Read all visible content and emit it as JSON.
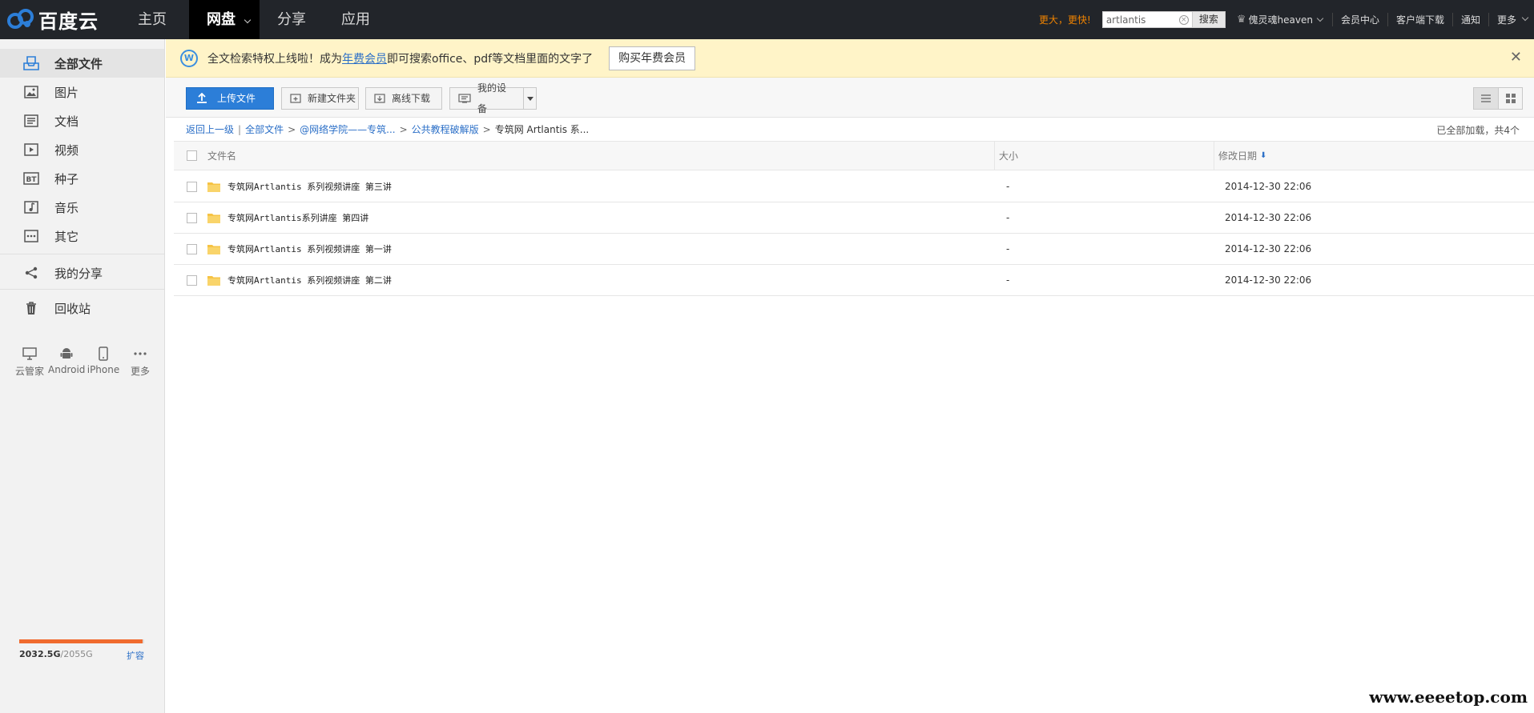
{
  "brand": {
    "name": "百度云"
  },
  "nav": {
    "items": [
      {
        "label": "主页"
      },
      {
        "label": "网盘"
      },
      {
        "label": "分享"
      },
      {
        "label": "应用"
      }
    ]
  },
  "topbar": {
    "promo": "更大，更快!",
    "search_value": "artlantis",
    "search_button": "搜索",
    "username": "傀灵魂heaven",
    "links": [
      "会员中心",
      "客户端下载",
      "通知"
    ],
    "more": "更多"
  },
  "sidebar": {
    "items": [
      {
        "label": "全部文件",
        "icon": "folder-all-icon"
      },
      {
        "label": "图片",
        "icon": "image-icon"
      },
      {
        "label": "文档",
        "icon": "document-icon"
      },
      {
        "label": "视频",
        "icon": "video-icon"
      },
      {
        "label": "种子",
        "icon": "bt-icon"
      },
      {
        "label": "音乐",
        "icon": "music-icon"
      },
      {
        "label": "其它",
        "icon": "other-icon"
      },
      {
        "label": "我的分享",
        "icon": "share-icon"
      },
      {
        "label": "回收站",
        "icon": "trash-icon"
      }
    ],
    "devices": [
      {
        "label": "云管家",
        "icon": "desktop-icon"
      },
      {
        "label": "Android",
        "icon": "android-icon"
      },
      {
        "label": "iPhone",
        "icon": "iphone-icon"
      },
      {
        "label": "更多",
        "icon": "more-dots-icon"
      }
    ],
    "quota": {
      "used": "2032.5G",
      "total": "/2055G",
      "fraction": 0.989,
      "expand": "扩容"
    }
  },
  "notice": {
    "text_before": "全文检索特权上线啦！成为",
    "link": "年费会员",
    "text_after": "即可搜索office、pdf等文档里面的文字了",
    "button": "购买年费会员"
  },
  "toolbar": {
    "upload": "上传文件",
    "new_folder": "新建文件夹",
    "offline_download": "离线下载",
    "my_devices": "我的设备"
  },
  "breadcrumb": {
    "back": "返回上一级",
    "items": [
      "全部文件",
      "@网络学院——专筑...",
      "公共教程破解版"
    ],
    "current": "专筑网 Artlantis 系...",
    "loaded": "已全部加载，共4个"
  },
  "table": {
    "headers": {
      "name": "文件名",
      "size": "大小",
      "date": "修改日期"
    },
    "rows": [
      {
        "name": "专筑网Artlantis 系列视频讲座 第三讲",
        "size": "-",
        "date": "2014-12-30 22:06"
      },
      {
        "name": "专筑网Artlantis系列讲座 第四讲",
        "size": "-",
        "date": "2014-12-30 22:06"
      },
      {
        "name": "专筑网Artlantis 系列视频讲座 第一讲",
        "size": "-",
        "date": "2014-12-30 22:06"
      },
      {
        "name": "专筑网Artlantis 系列视频讲座 第二讲",
        "size": "-",
        "date": "2014-12-30 22:06"
      }
    ]
  },
  "watermark": "www.eeeetop.com",
  "colors": {
    "accent": "#2c7ed8",
    "topbar": "#22252a",
    "notice_bg": "#fff4c8",
    "quota": "#f06b2e",
    "promo": "#f08300"
  }
}
